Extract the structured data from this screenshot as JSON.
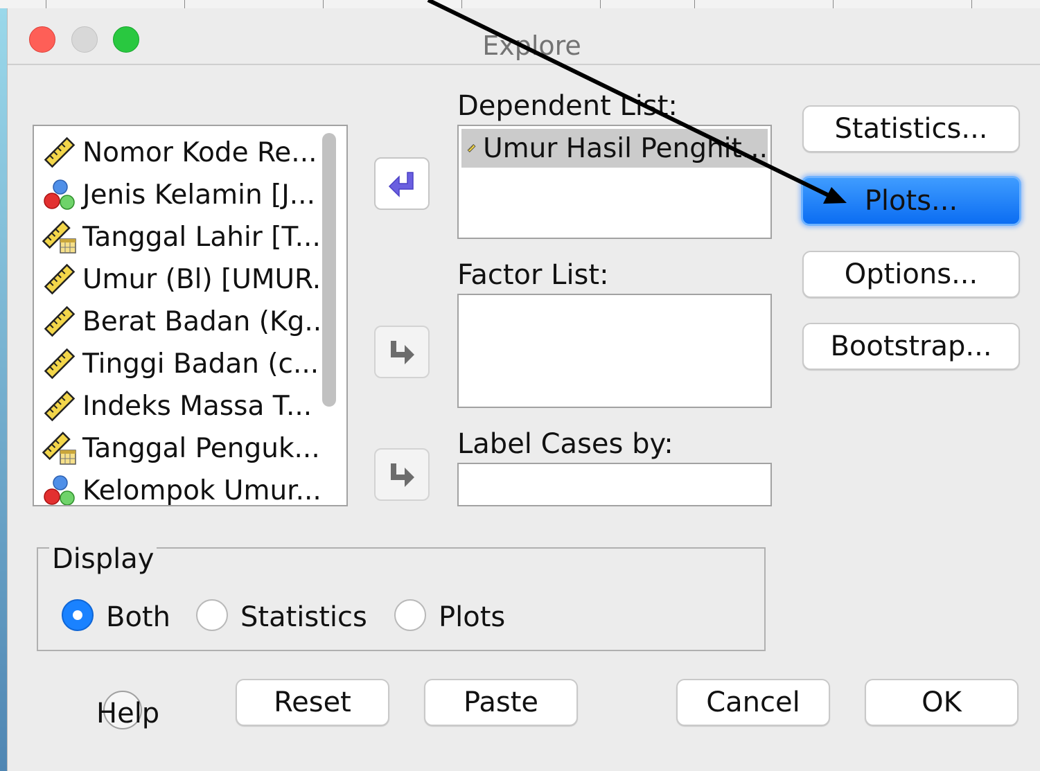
{
  "window": {
    "title": "Explore"
  },
  "variables": [
    {
      "label": "Nomor Kode Re...",
      "icon": "scale-ruler-icon"
    },
    {
      "label": "Jenis Kelamin [J...",
      "icon": "nominal-balls-icon"
    },
    {
      "label": "Tanggal Lahir [T...",
      "icon": "date-ruler-icon"
    },
    {
      "label": "Umur (Bl) [UMUR...",
      "icon": "scale-ruler-icon"
    },
    {
      "label": "Berat Badan (Kg...",
      "icon": "scale-ruler-icon"
    },
    {
      "label": "Tinggi Badan (c...",
      "icon": "scale-ruler-icon"
    },
    {
      "label": "Indeks Massa T...",
      "icon": "scale-ruler-icon"
    },
    {
      "label": "Tanggal Penguk...",
      "icon": "date-ruler-icon"
    },
    {
      "label": "Kelompok Umur...",
      "icon": "nominal-balls-icon"
    }
  ],
  "dependent_list": {
    "label": "Dependent List:",
    "items": [
      "Umur Hasil Penghit..."
    ]
  },
  "factor_list": {
    "label": "Factor List:"
  },
  "label_cases": {
    "label": "Label Cases by:"
  },
  "side_buttons": {
    "statistics": "Statistics...",
    "plots": "Plots...",
    "options": "Options...",
    "bootstrap": "Bootstrap..."
  },
  "display": {
    "legend": "Display",
    "options": [
      "Both",
      "Statistics",
      "Plots"
    ],
    "selected": "Both"
  },
  "footer": {
    "help": "Help",
    "reset": "Reset",
    "paste": "Paste",
    "cancel": "Cancel",
    "ok": "OK"
  },
  "colors": {
    "primary_button": "#1a7cff",
    "annotation_arrow": "#000000"
  }
}
